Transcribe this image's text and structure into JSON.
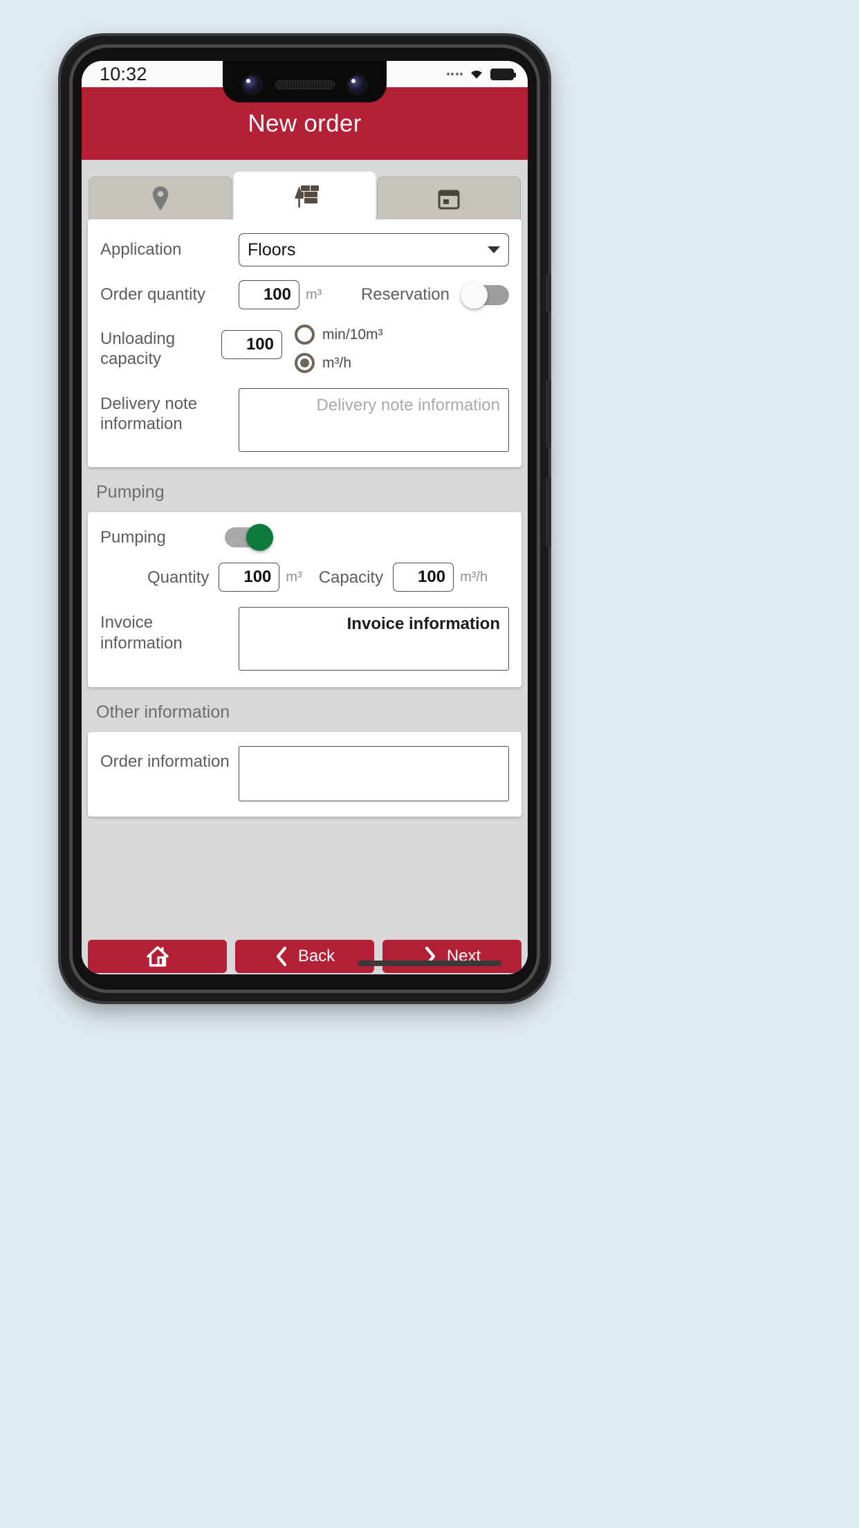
{
  "status": {
    "time": "10:32",
    "signal_icon": "signal-dots-icon",
    "wifi_icon": "wifi-icon",
    "battery_icon": "battery-icon"
  },
  "header": {
    "title": "New order",
    "color": "#b31f35"
  },
  "tabs": [
    {
      "name": "tab-location",
      "icon": "map-pin-icon",
      "active": false
    },
    {
      "name": "tab-product",
      "icon": "brick-wall-trowel-icon",
      "active": true
    },
    {
      "name": "tab-schedule",
      "icon": "calendar-icon",
      "active": false
    }
  ],
  "order_card": {
    "application": {
      "label": "Application",
      "value": "Floors",
      "dropdown_icon": "chevron-down-icon"
    },
    "order_quantity": {
      "label": "Order quantity",
      "value": "100",
      "unit": "m³"
    },
    "reservation": {
      "label": "Reservation",
      "state": "off"
    },
    "unloading_capacity": {
      "label": "Unloading capacity",
      "value": "100",
      "options": [
        {
          "label": "min/10m³",
          "selected": false
        },
        {
          "label": "m³/h",
          "selected": true
        }
      ]
    },
    "delivery_note": {
      "label": "Delivery note information",
      "placeholder": "Delivery note information",
      "value": ""
    }
  },
  "pumping_section": {
    "title": "Pumping",
    "toggle": {
      "label": "Pumping",
      "state": "on",
      "color": "#0f7a3d"
    },
    "quantity": {
      "label": "Quantity",
      "value": "100",
      "unit": "m³"
    },
    "capacity": {
      "label": "Capacity",
      "value": "100",
      "unit": "m³/h"
    },
    "invoice": {
      "label": "Invoice information",
      "value": "Invoice information"
    }
  },
  "other_section": {
    "title": "Other information",
    "order_information": {
      "label": "Order information",
      "value": ""
    }
  },
  "bottom_nav": [
    {
      "name": "home-button",
      "label": "",
      "icon": "home-icon"
    },
    {
      "name": "back-button",
      "label": "Back",
      "icon": "chevron-left-icon"
    },
    {
      "name": "next-button",
      "label": "Next",
      "icon": "chevron-right-icon"
    }
  ]
}
